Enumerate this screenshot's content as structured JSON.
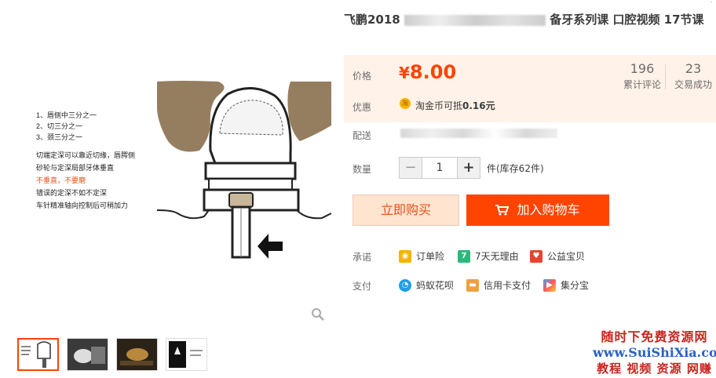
{
  "product": {
    "title_start": "飞鹏2018",
    "title_end": "备牙系列课 口腔视频 17节课"
  },
  "price": {
    "label": "价格",
    "currency": "¥",
    "value": "8.00",
    "reviews_count": "196",
    "reviews_label": "累计评论",
    "trades_count": "23",
    "trades_label": "交易成功"
  },
  "promo": {
    "label": "优惠",
    "coin_glyph": "淘",
    "text": "淘金币可抵",
    "amount": "0.16元"
  },
  "shipping": {
    "label": "配送"
  },
  "quantity": {
    "label": "数量",
    "minus": "−",
    "value": "1",
    "plus": "+",
    "stock_text": "件(库存62件)"
  },
  "actions": {
    "buy_now": "立即购买",
    "add_to_cart": "加入购物车"
  },
  "promise": {
    "label": "承诺",
    "items": [
      "订单险",
      "7天无理由",
      "公益宝贝"
    ]
  },
  "payment": {
    "label": "支付",
    "items": [
      "蚂蚁花呗",
      "信用卡支付",
      "集分宝"
    ]
  },
  "diagram": {
    "notes": [
      "1、唇侧中三分之一",
      "2、切三分之一",
      "3、颈三分之一"
    ],
    "lines": [
      "切端定深可以靠近切缘，唇腭侧",
      "砂轮与定深局部牙体垂直",
      "不垂直，不要磨",
      "错误的定深不如不定深",
      "车针精准轴向控制后可稍加力"
    ]
  },
  "watermark": {
    "line1": "随时下免费资源网",
    "line2": "www.SuiShiXia.com",
    "line3": "教程 视频 资源 网赚"
  },
  "colors": {
    "accent": "#ff4400",
    "price": "#ff4400",
    "price_bg": "#fff2e8"
  }
}
